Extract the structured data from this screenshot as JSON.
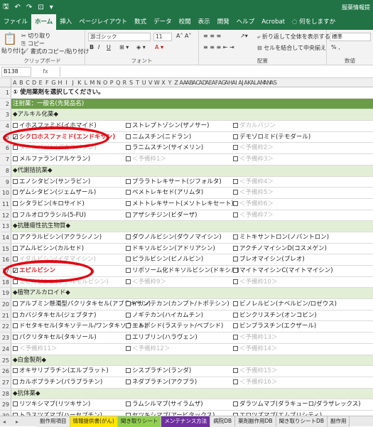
{
  "title_bar": {
    "save_glyph": "🖫",
    "undo_glyph": "↶",
    "redo_glyph": "↷",
    "preview_glyph": "⊡",
    "more_glyph": "▾",
    "doc_name": "服薬情報提"
  },
  "tabs": [
    "ファイル",
    "ホーム",
    "挿入",
    "ページレイアウト",
    "数式",
    "データ",
    "校閲",
    "表示",
    "開発",
    "ヘルプ",
    "Acrobat"
  ],
  "tell_me": "何をしますか",
  "ribbon": {
    "paste": "貼り付け",
    "cut": "切り取り",
    "copy": "コピー",
    "format_painter": "書式のコピー/貼り付け",
    "clipboard": "クリップボード",
    "font_name": "游ゴシック",
    "font_size": "11",
    "font_group": "フォント",
    "bold": "B",
    "italic": "I",
    "underline": "U",
    "wrap": "折り返して全体を表示する",
    "merge": "セルを結合して中央揃え",
    "alignment": "配置",
    "number_format": "標準",
    "number_group": "数値",
    "percent": "% ,"
  },
  "name_box": "B138",
  "fx": "fx",
  "col_letters": [
    "A",
    "B",
    "C",
    "D",
    "E",
    "F",
    "G",
    "H",
    "I",
    "J",
    "K",
    "L",
    "M",
    "N",
    "O",
    "P",
    "Q",
    "R",
    "S",
    "T",
    "U",
    "V",
    "W",
    "X",
    "Y",
    "Z",
    "AA",
    "AB",
    "AC",
    "AD",
    "AE",
    "AF",
    "AG",
    "AH",
    "AI",
    "AJ",
    "AK",
    "AL",
    "AM",
    "AN",
    "AS"
  ],
  "rows": [
    {
      "n": "1",
      "type": "plain",
      "c1": "① 使用薬剤を選択してください。"
    },
    {
      "n": "2",
      "type": "green",
      "c1": "注射薬：一般名(先発品名)"
    },
    {
      "n": "3",
      "type": "lgreen",
      "c1": "◆アルキル化薬◆"
    },
    {
      "n": "4",
      "c1": "イホスファミド(イホマイド)",
      "c2": "ストレプトゾシン(ザノサー)",
      "c3": "ダカルバジン",
      "g3": true
    },
    {
      "n": "5",
      "c1": "シクロホスファミド(エンドキサン)",
      "c1red": true,
      "c1on": true,
      "c2": "ニムスチン(ニドラン)",
      "c3": "デモゾロミド(テモダール)"
    },
    {
      "n": "6",
      "c1": "ダカルバジン(ダカルバジン)",
      "g1": true,
      "c2": "ラニムスチン(サイメリン)",
      "c3": "＜予備枠2＞",
      "g3": true
    },
    {
      "n": "7",
      "c1": "メルファラン(アルケラン)",
      "c2": "＜予備枠1＞",
      "g2": true,
      "c3": "＜予備枠3＞",
      "g3": true
    },
    {
      "n": "8",
      "type": "lgreen",
      "c1": "◆代謝拮抗薬◆"
    },
    {
      "n": "9",
      "c1": "エノシタビン(サンラビン)",
      "c2": "プララトレキサート(ジフォルタ)",
      "c3": "＜予備枠4＞",
      "g3": true
    },
    {
      "n": "10",
      "c1": "ゲムシタビン(ジェムザール)",
      "c2": "ペメトレキセド(アリムタ)",
      "c3": "＜予備枠5＞",
      "g3": true
    },
    {
      "n": "11",
      "c1": "シタラビン(キロサイド)",
      "c2": "メトトレキサート(メソトレキセート)",
      "c3": "＜予備枠6＞",
      "g3": true
    },
    {
      "n": "12",
      "c1": "フルオロウラシル(5-FU)",
      "c2": "アザシチジン(ビダーザ)",
      "c3": "＜予備枠7＞",
      "g3": true
    },
    {
      "n": "13",
      "type": "lgreen",
      "c1": "◆抗腫瘍性抗生物質◆"
    },
    {
      "n": "14",
      "c1": "アクラルビシン(アクラシノン)",
      "c2": "ダウノルビシン(ダウノマイシン)",
      "c3": "ミトキサントロン(ノバントロン)"
    },
    {
      "n": "15",
      "c1": "アムルビシン(カルセド)",
      "c2": "ドキソルビシン(アドリアシン)",
      "c3": "アクチノマイシンD(コスメゲン)"
    },
    {
      "n": "16",
      "c1": "イダルビシン(イダマイシン)",
      "g1": true,
      "c2": "ピラルビシン(ピノルビン)",
      "c3": "ブレオマイシン(ブレオ)"
    },
    {
      "n": "17",
      "c1": "エピルビシン",
      "c1red": true,
      "c1on": true,
      "c2": "リポソーム化ドキソルビシン(ドキシル)",
      "c3": "マイトマイシンC(マイトマイシン)"
    },
    {
      "n": "18",
      "c1": "エピルビシン(ファルモルビシン)",
      "g1": true,
      "c2": "＜予備枠9＞",
      "g2": true,
      "c3": "＜予備枠10＞",
      "g3": true
    },
    {
      "n": "19",
      "type": "lgreen",
      "c1": "◆植物アルカロイド◆"
    },
    {
      "n": "20",
      "c1": "アルブミン懸濁型パクリタキセル(アブラキサン)",
      "c2": "イリノテカン(カンプト/トポテシン)",
      "c3": "ビノレルビン(ナベルビン/ロゼウス)"
    },
    {
      "n": "21",
      "c1": "カバジタキセル(ジェブタナ)",
      "c2": "ノギテカン(ハイカムチン)",
      "c3": "ビンクリスチン(オンコビン)"
    },
    {
      "n": "22",
      "c1": "ドセタキセル(タキソテール/ワンタキソテール)",
      "c2": "エトポシド(ラステット/ベプシド)",
      "c3": "ビンブラスチン(エクザール)"
    },
    {
      "n": "23",
      "c1": "パクリタキセル(タキソール)",
      "c2": "エリブリン(ハラヴェン)",
      "c3": "＜予備枠13＞",
      "g3": true
    },
    {
      "n": "24",
      "c1": "＜予備枠11＞",
      "g1": true,
      "c2": "＜予備枠12＞",
      "g2": true,
      "c3": "＜予備枠14＞",
      "g3": true
    },
    {
      "n": "25",
      "type": "lgreen",
      "c1": "◆白金製剤◆"
    },
    {
      "n": "26",
      "c1": "オキサリプラチン(エルプラット)",
      "c2": "シスプラチン(ランダ)",
      "c3": "＜予備枠15＞",
      "g3": true
    },
    {
      "n": "27",
      "c1": "カルボプラチン(パラプラチン)",
      "c2": "ネダプラチン(アクプラ)",
      "c3": "＜予備枠16＞",
      "g3": true
    },
    {
      "n": "28",
      "type": "lgreen",
      "c1": "◆抗体薬◆"
    },
    {
      "n": "29",
      "c1": "リツキシマブ(リツキサン)",
      "c2": "ラムシルマブ(サイラムザ)",
      "c3": "ダラツムマブ(ダラキューロ/ダラザレックス)"
    },
    {
      "n": "30",
      "c1": "トラスツズマブ(ハーセプチン)",
      "c2": "セツキシマブ(アービタックス)",
      "c3": "エロツズマブ(エムプリシティ)"
    }
  ],
  "sheet_nav": "◂ ▸",
  "sheet_tabs": [
    {
      "label": "副作用項目",
      "color": "#e9e9e9"
    },
    {
      "label": "情報提供書(がん)",
      "color": "#ffe600"
    },
    {
      "label": "聞き取りシート",
      "color": "#92d050"
    },
    {
      "label": "メンテナンス方法",
      "color": "#7030a0",
      "text": "#ffffff"
    },
    {
      "label": "病院DB",
      "color": "#e9e9e9"
    },
    {
      "label": "薬剤副作用DB",
      "color": "#e9e9e9"
    },
    {
      "label": "聞き取りシートDB",
      "color": "#e9e9e9"
    },
    {
      "label": "副作用",
      "color": "#e9e9e9"
    }
  ],
  "colors": {
    "excel_green": "#217346",
    "header_green": "#6b9d48",
    "section_green": "#e3eed7",
    "highlight_red": "#e30613"
  }
}
